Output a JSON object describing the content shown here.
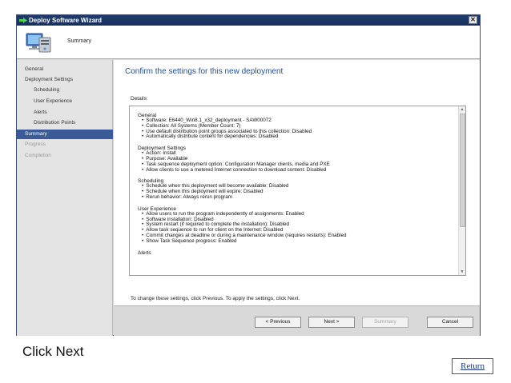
{
  "window": {
    "title": "Deploy Software Wizard",
    "close_glyph": "✕"
  },
  "header": {
    "title": "Summary",
    "icon": "computer-install-icon"
  },
  "nav": {
    "items": [
      {
        "label": "General",
        "level": "top",
        "state": "normal"
      },
      {
        "label": "Deployment Settings",
        "level": "top",
        "state": "normal"
      },
      {
        "label": "Scheduling",
        "level": "sub",
        "state": "normal"
      },
      {
        "label": "User Experience",
        "level": "sub",
        "state": "normal"
      },
      {
        "label": "Alerts",
        "level": "sub",
        "state": "normal"
      },
      {
        "label": "Distribution Points",
        "level": "sub",
        "state": "normal"
      },
      {
        "label": "Summary",
        "level": "top",
        "state": "active"
      },
      {
        "label": "Progress",
        "level": "top",
        "state": "dim"
      },
      {
        "label": "Completion",
        "level": "top",
        "state": "dim"
      }
    ]
  },
  "content": {
    "title": "Confirm the settings for this new deployment",
    "details_label": "Details:",
    "sections": [
      {
        "heading": "General",
        "items": [
          "Software: E6440_Win8.1_x32_deployment - SAW00072",
          "Collection: All Systems (Member Count: 7)",
          "Use default distribution point groups associated to this collection: Disabled",
          "Automatically distribute content for dependencies: Disabled"
        ]
      },
      {
        "heading": "Deployment Settings",
        "items": [
          "Action: Install",
          "Purpose: Available",
          "Task sequence deployment option: Configuration Manager clients, media and PXE",
          "Allow clients to use a metered Internet connection to download content: Disabled"
        ]
      },
      {
        "heading": "Scheduling",
        "items": [
          "Schedule when this deployment will become available: Disabled",
          "Schedule when this deployment will expire: Disabled",
          "Rerun behavior: Always rerun program"
        ]
      },
      {
        "heading": "User Experience",
        "items": [
          "Allow users to run the program independently of assignments: Enabled",
          "Software installation: Disabled",
          "System restart (if required to complete the installation): Disabled",
          "Allow task sequence to run for client on the Internet: Disabled",
          "Commit changes at deadline or during a maintenance window (requires restarts): Enabled",
          "Show Task Sequence progress: Enabled"
        ]
      },
      {
        "heading": "Alerts",
        "items": []
      }
    ],
    "instruction": "To change these settings, click Previous. To apply the settings, click Next."
  },
  "buttons": {
    "previous": "< Previous",
    "next": "Next >",
    "summary": "Summary",
    "cancel": "Cancel"
  },
  "slide": {
    "caption": "Click Next",
    "return_label": "Return"
  },
  "colors": {
    "title_blue": "#1c4f9c",
    "nav_active": "#3a5a98",
    "titlebar": "#203c6c"
  }
}
